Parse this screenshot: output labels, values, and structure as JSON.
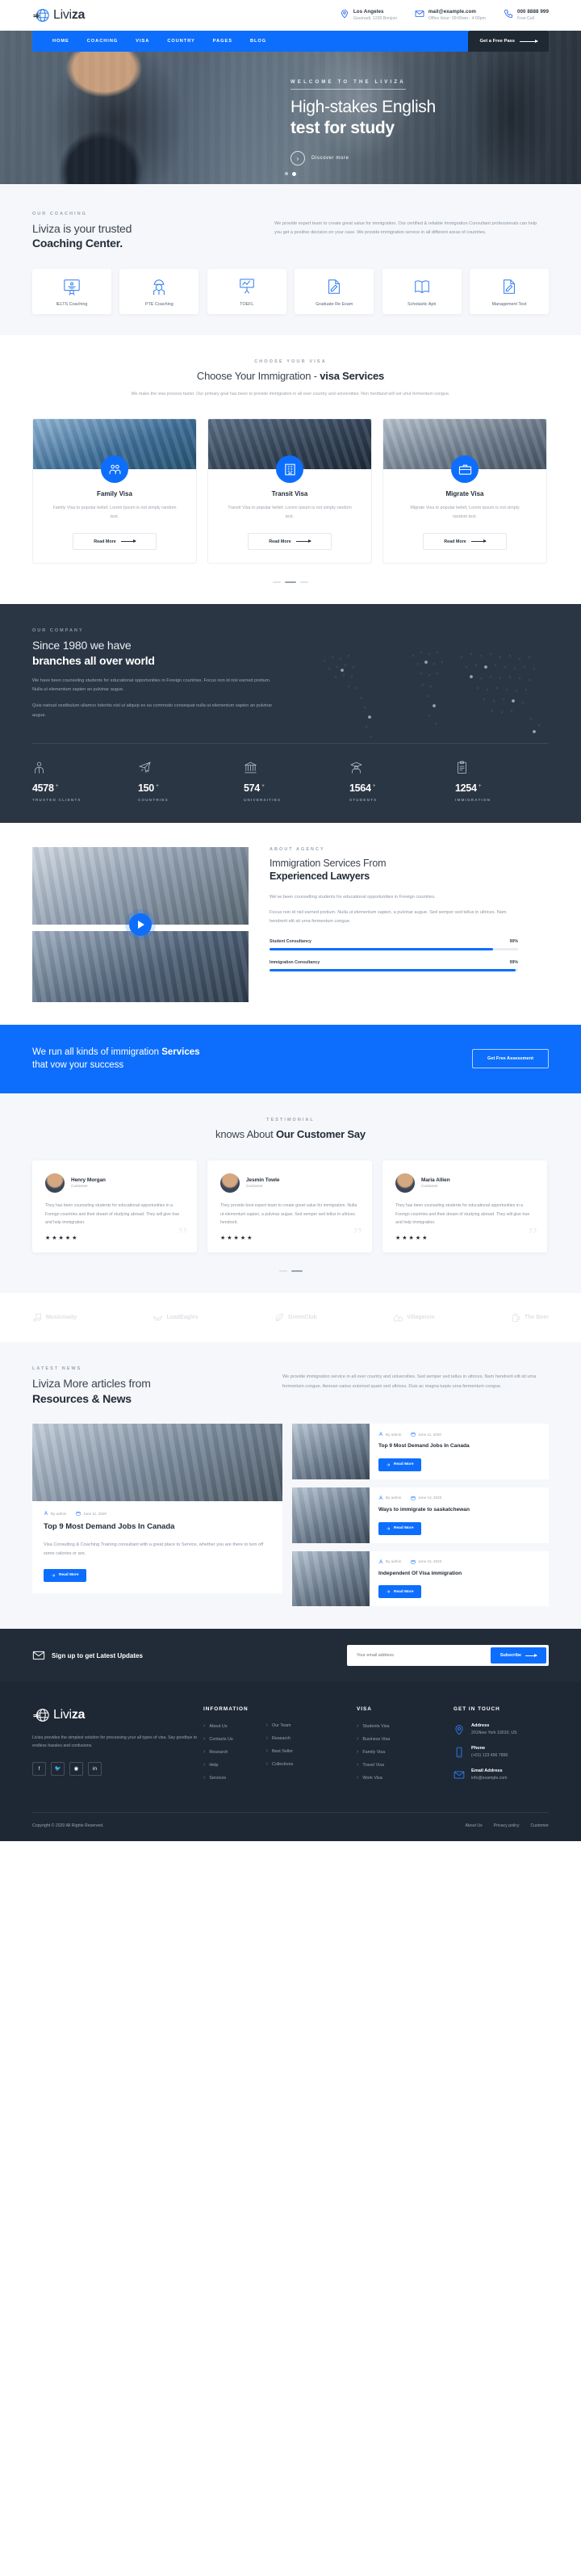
{
  "brand": {
    "name_light": "Livi",
    "name_bold": "za",
    "logo_icon": "globe-plane-icon"
  },
  "topbar": {
    "items": [
      {
        "icon": "location-pin-icon",
        "title": "Los Angeles",
        "sub": "Goumadi, 1230 Bonjosi"
      },
      {
        "icon": "envelope-icon",
        "title": "mail@example.com",
        "sub": "Office Hour: 09:00am - 4:00pm"
      },
      {
        "icon": "phone-icon",
        "title": "000 8888 999",
        "sub": "Free Call"
      }
    ]
  },
  "nav": {
    "links": [
      "HOME",
      "COACHING",
      "VISA",
      "COUNTRY",
      "PAGES",
      "BLOG"
    ],
    "active": "HOME",
    "cta": "Get a Free Pass"
  },
  "hero": {
    "kicker": "WELCOME TO THE LIVIZA",
    "title_light": "High-stakes English",
    "title_bold": "test for study",
    "button": "Discover more",
    "slides": 2,
    "active_slide": 2
  },
  "coaching": {
    "eyebrow": "OUR COACHING",
    "title_light": "Liviza is your trusted",
    "title_bold": "Coaching Center.",
    "paragraph": "We provide expert team to create great value for immigration. Our certified & reliable Immigration Consultant professionals can help you get a positive decision on your case. We provide immigration service in all different areas of countries.",
    "cards": [
      {
        "icon": "certificate-icon",
        "label": "IELTS Coaching"
      },
      {
        "icon": "worker-icon",
        "label": "PTE Coaching"
      },
      {
        "icon": "presentation-icon",
        "label": "TOEFL"
      },
      {
        "icon": "document-edit-icon",
        "label": "Graduate Re Exam"
      },
      {
        "icon": "open-book-icon",
        "label": "Scholastic Apti"
      },
      {
        "icon": "document-edit-icon",
        "label": "Management Test"
      }
    ]
  },
  "visa": {
    "eyebrow": "CHOOSE YOUR VISA",
    "title_light": "Choose Your Immigration - ",
    "title_bold": "visa Services",
    "subtitle": "We make the visa process faster. Our primary goal has been to provide immigration in all over country and universities. Non herdtand will set uhut fermentum congue.",
    "cards": [
      {
        "title": "Family Visa",
        "text": "Family Visa to popular belief, Lorem Ipsum is not simply random text.",
        "button": "Read More",
        "icon": "family-icon"
      },
      {
        "title": "Transit Visa",
        "text": "Transit Visa to popular belief, Lorem Ipsum is not simply random text.",
        "button": "Read More",
        "icon": "building-icon"
      },
      {
        "title": "Migrate Visa",
        "text": "Migrate Visa to popular belief, Lorem Ipsum is not simply random text.",
        "button": "Read More",
        "icon": "suitcase-icon"
      }
    ]
  },
  "company": {
    "eyebrow": "OUR COMPANY",
    "title_light": "Since 1980 we have",
    "title_bold": "branches all over world",
    "paragraph1": "We have been counseling students for educational opportunities in Foreign countries. Focus non id nisl earned pretium. Nulla ut elementum sapien an pulvinar augue.",
    "paragraph2": "Quis natoud vestibulum ullamco lobortis nisl ut aliquip ex ea commodo consequat nulla ut elementum sapien an pulvinar augue.",
    "stats": [
      {
        "icon": "person-icon",
        "value": "4578",
        "plus": "+",
        "caption": "TRUSTED CLIENTS"
      },
      {
        "icon": "plane-icon",
        "value": "150",
        "plus": "+",
        "caption": "COUNTRIES"
      },
      {
        "icon": "bank-icon",
        "value": "574",
        "plus": "+",
        "caption": "UNIVERSITIES"
      },
      {
        "icon": "graduate-icon",
        "value": "1564",
        "plus": "+",
        "caption": "STUDENTS"
      },
      {
        "icon": "clipboard-icon",
        "value": "1254",
        "plus": "+",
        "caption": "IMMIGRATION"
      }
    ]
  },
  "lawyers": {
    "eyebrow": "ABOUT AGENCY",
    "title_light": "Immigration Services From",
    "title_bold": "Experienced Lawyers",
    "paragraph1": "We've been counselling students for educational opportunities in Foreign countries.",
    "paragraph2": "Focus non id nisl earned pretium. Nulla ut elementum sapien, a pulvinar augue. Sed semper sed tellus in ultrices. Nam hendrerit elit sit urna fermentum congue.",
    "play_icon": "play-icon",
    "bars": [
      {
        "label": "Student Consultancy",
        "value": "90%",
        "pct": 90
      },
      {
        "label": "Immigration Consultancy",
        "value": "99%",
        "pct": 99
      }
    ]
  },
  "cta": {
    "title_light": "We run all kinds of immigration ",
    "title_bold": "Services",
    "title_line2": "that vow your success",
    "button": "Get Free Assessment"
  },
  "testimonials": {
    "eyebrow": "TESTIMONIAL",
    "title_light": "knows About ",
    "title_bold": "Our Customer Say",
    "items": [
      {
        "name": "Henry Morgan",
        "role": "Customer",
        "text": "They has been counseling students for educational opportunities in a Foreign countries and their dream of studying abroad. They will give true and help immigration.",
        "stars": "★★★★★"
      },
      {
        "name": "Jesmin Towle",
        "role": "Customer",
        "text": "They provide best expert team to create great value for immigration. Nulla ut elementum sapien, a pulvinar augue. Sed semper sed tellus in ultrices hendrerit.",
        "stars": "★★★★★"
      },
      {
        "name": "Maria Allien",
        "role": "Customer",
        "text": "They has been counseling students for educational opportunities in a Foreign countries and their dream of studying abroad. They will give true and help immigration.",
        "stars": "★★★★★"
      }
    ]
  },
  "logos": [
    {
      "name": "Musicmaity",
      "icon": "music-icon"
    },
    {
      "name": "LoadEagles",
      "icon": "eagle-icon"
    },
    {
      "name": "GreenClub",
      "icon": "leaf-icon"
    },
    {
      "name": "Villageism",
      "icon": "village-icon"
    },
    {
      "name": "The Beer",
      "icon": "beer-icon"
    }
  ],
  "news": {
    "eyebrow": "LATEST NEWS",
    "title_light": "Liviza More articles from",
    "title_bold": "Resources & News",
    "paragraph": "We provide immigration service in all over country and universities. Sed semper sed tellus in ultrices. Nam hendrerit elit sit urna fermentum congue. Aenean varius euismod quam sed ultrices. Duis ac magna turpis urna fermentum congue.",
    "main": {
      "author": "By admin",
      "date": "June 11, 2020",
      "title": "Top 9 Most Demand Jobs In Canada",
      "text": "Visa Consulting & Coaching Training consultant with a great place to Service, whether you are there to turn off some calories or are.",
      "button": "Read More"
    },
    "side": [
      {
        "author": "By admin",
        "date": "June 11, 2020",
        "title": "Top 9 Most Demand Jobs In Canada",
        "button": "Read More"
      },
      {
        "author": "By admin",
        "date": "June 13, 2020",
        "title": "Ways to immigrate to saskatchewan",
        "button": "Read More"
      },
      {
        "author": "By admin",
        "date": "June 15, 2020",
        "title": "Independent Of Visa immigration",
        "button": "Read More"
      }
    ]
  },
  "subscribe": {
    "icon": "envelope-icon",
    "title": "Sign up to get Latest Updates",
    "placeholder": "Your email address",
    "button": "Subscribe"
  },
  "footer": {
    "about": "Liviza provides the simplest solution for processing your all types of visa. Say goodbye to endless hassles and confusions.",
    "socials": [
      {
        "name": "facebook-icon",
        "glyph": "f"
      },
      {
        "name": "twitter-icon",
        "glyph": "🐦"
      },
      {
        "name": "dribbble-icon",
        "glyph": "◉"
      },
      {
        "name": "linkedin-icon",
        "glyph": "in"
      }
    ],
    "information": {
      "title": "INFORMATION",
      "col1": [
        "About Us",
        "Contacts Us",
        "Research",
        "Help",
        "Services"
      ],
      "col2": [
        "Our Team",
        "Research",
        "Best Seller",
        "Collections"
      ]
    },
    "visa": {
      "title": "VISA",
      "items": [
        "Students Visa",
        "Business Visa",
        "Family Visa",
        "Travel Visa",
        "Work Visa"
      ]
    },
    "touch": {
      "title": "GET IN TOUCH",
      "items": [
        {
          "icon": "location-pin-icon",
          "label": "Address",
          "value": "201New York 10010, US"
        },
        {
          "icon": "phone-icon",
          "label": "Phone",
          "value": "(+01) 123 456 7890"
        },
        {
          "icon": "envelope-icon",
          "label": "Email Address",
          "value": "info@example.com"
        }
      ]
    },
    "copyright": "Copyright © 2020 All Rights Reserved.",
    "bottom_links": [
      "About Us",
      "Privacy policy",
      "Customer"
    ]
  },
  "colors": {
    "accent": "#0d6efd",
    "dark": "#2b3644",
    "footer": "#1e2835",
    "light": "#f5f7fa"
  }
}
